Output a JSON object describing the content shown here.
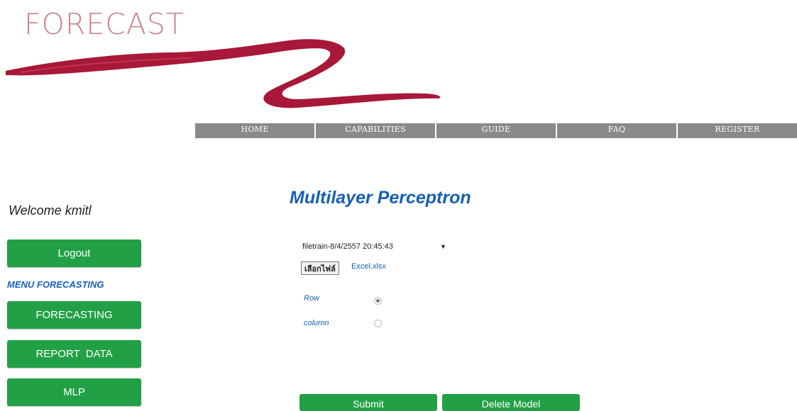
{
  "logo": {
    "text": "FORECAST",
    "swoosh_color": "#a81838"
  },
  "nav": {
    "items": [
      {
        "label": "HOME"
      },
      {
        "label": "CAPABILITIES"
      },
      {
        "label": "GUIDE"
      },
      {
        "label": "FAQ"
      },
      {
        "label": "REGISTER"
      }
    ]
  },
  "sidebar": {
    "welcome": "Welcome kmitl",
    "logout_label": "Logout",
    "menu_title": "MENU FORECASTING",
    "menu_items": [
      {
        "label": "FORECASTING"
      },
      {
        "label": "REPORT  DATA"
      },
      {
        "label": "MLP"
      }
    ]
  },
  "main": {
    "title": "Multilayer Perceptron",
    "file_select": {
      "selected": "filetrain-8/4/2557 20:45:43"
    },
    "file_input": {
      "button_label": "เลือกไฟล์",
      "file_name": "Excel.xlsx"
    },
    "options": [
      {
        "label": "Row",
        "checked": true
      },
      {
        "label": "column",
        "checked": false
      }
    ],
    "submit_label": "Submit",
    "delete_label": "Delete Model"
  },
  "colors": {
    "accent_green": "#22a046",
    "title_blue": "#1760b5",
    "nav_gray": "#8a8a8a",
    "logo_pink": "#c8838b"
  }
}
